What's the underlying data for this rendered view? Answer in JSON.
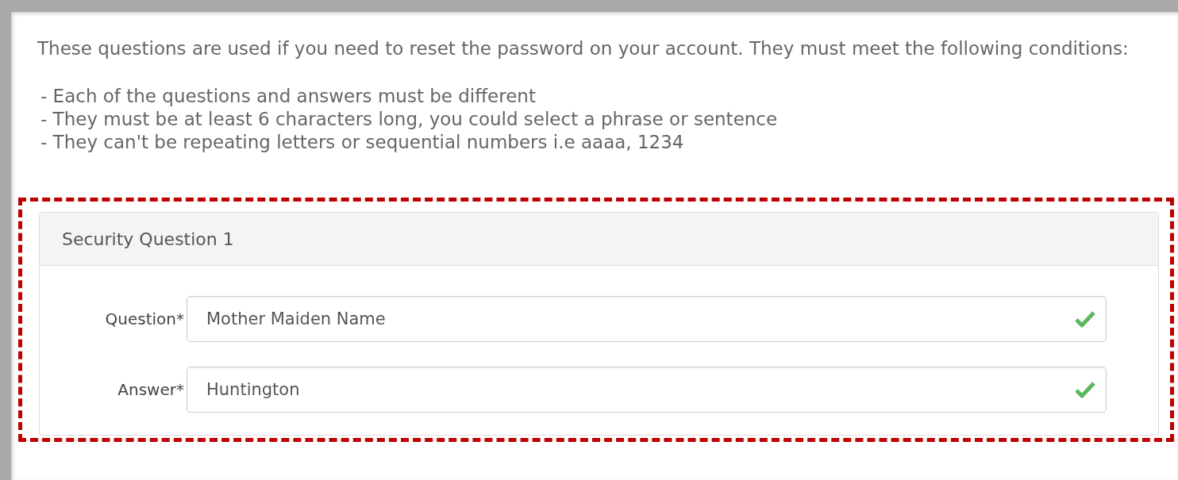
{
  "intro": "These questions are used if you need to reset the password on your account. They must meet the following conditions:",
  "conditions": [
    "- Each of the questions and answers must be different",
    "- They must be at least 6 characters long, you could select a phrase or sentence",
    "- They can't be repeating letters or sequential numbers i.e aaaa, 1234"
  ],
  "panel": {
    "title": "Security Question 1",
    "highlighted": true,
    "fields": [
      {
        "label": "Question*",
        "value": "Mother Maiden Name",
        "valid": true
      },
      {
        "label": "Answer*",
        "value": "Huntington",
        "valid": true
      }
    ]
  }
}
